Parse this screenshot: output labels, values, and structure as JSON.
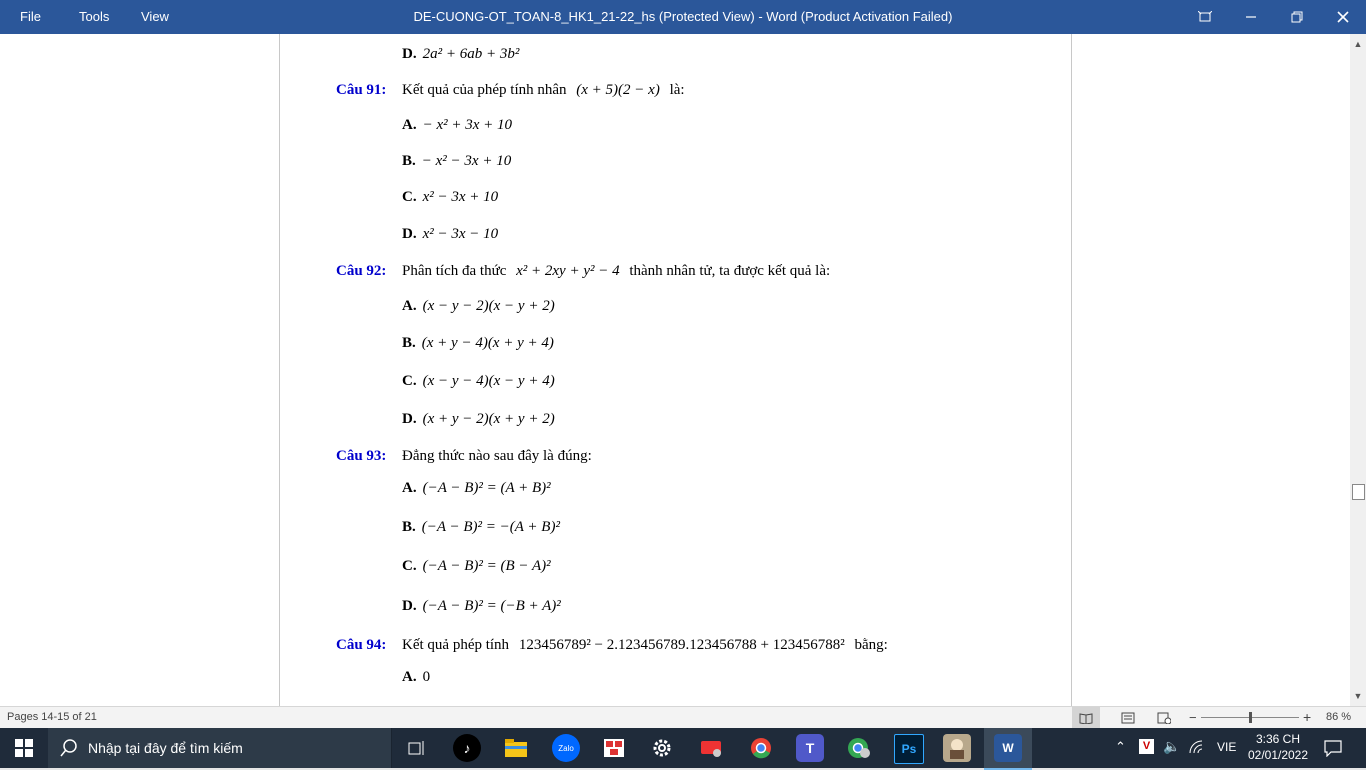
{
  "window": {
    "title": "DE-CUONG-OT_TOAN-8_HK1_21-22_hs (Protected View) - Word (Product Activation Failed)",
    "menu": [
      "File",
      "Tools",
      "View"
    ],
    "accent": "#2b579a"
  },
  "document": {
    "prev_option": {
      "label": "D.",
      "expr": "2a² + 6ab + 3b²"
    },
    "questions": [
      {
        "label": "Câu 91:",
        "text_before": "Kết quả của phép tính nhân",
        "expr": "(x + 5)(2 − x)",
        "text_after": "là:",
        "options": [
          {
            "label": "A.",
            "expr": "− x² + 3x + 10"
          },
          {
            "label": "B.",
            "expr": "− x² − 3x + 10"
          },
          {
            "label": "C.",
            "expr": "x² − 3x + 10"
          },
          {
            "label": "D.",
            "expr": "x² − 3x − 10"
          }
        ]
      },
      {
        "label": "Câu 92:",
        "text_before": "Phân tích đa thức",
        "expr": "x² + 2xy + y² − 4",
        "text_after": "thành nhân tử, ta được kết quả là:",
        "options": [
          {
            "label": "A.",
            "expr": "(x − y − 2)(x − y + 2)"
          },
          {
            "label": "B.",
            "expr": "(x + y − 4)(x + y + 4)"
          },
          {
            "label": "C.",
            "expr": "(x − y − 4)(x − y + 4)"
          },
          {
            "label": "D.",
            "expr": "(x + y − 2)(x + y + 2)"
          }
        ]
      },
      {
        "label": "Câu 93:",
        "text_before": "Đẳng thức nào sau đây là đúng:",
        "expr": "",
        "text_after": "",
        "options": [
          {
            "label": "A.",
            "expr": "(−A − B)² = (A + B)²"
          },
          {
            "label": "B.",
            "expr": "(−A − B)² = −(A + B)²"
          },
          {
            "label": "C.",
            "expr": "(−A − B)² = (B − A)²"
          },
          {
            "label": "D.",
            "expr": "(−A − B)² = (−B + A)²"
          }
        ]
      },
      {
        "label": "Câu 94:",
        "text_before": "Kết quả phép tính",
        "expr": "123456789² − 2.123456789.123456788 + 123456788²",
        "text_after": "bằng:",
        "options": [
          {
            "label": "A.",
            "expr": "0"
          }
        ]
      }
    ]
  },
  "statusbar": {
    "pages": "Pages 14-15 of 21",
    "zoom": "86 %",
    "zoom_fraction": 0.5
  },
  "taskbar": {
    "search_placeholder": "Nhập tại đây để tìm kiếm",
    "language": "VIE",
    "time": "3:36 CH",
    "date": "02/01/2022",
    "apps": [
      "task-view-icon",
      "tiktok-icon",
      "file-explorer-icon",
      "zalo-icon",
      "app-icon",
      "settings-icon",
      "mail-icon",
      "chrome-icon",
      "teams-icon",
      "chrome-profile-icon",
      "photoshop-icon",
      "game-icon",
      "word-icon"
    ],
    "zalo_label": "Zalo",
    "ps_label": "Ps",
    "word_label": "W",
    "v_label": "V"
  }
}
